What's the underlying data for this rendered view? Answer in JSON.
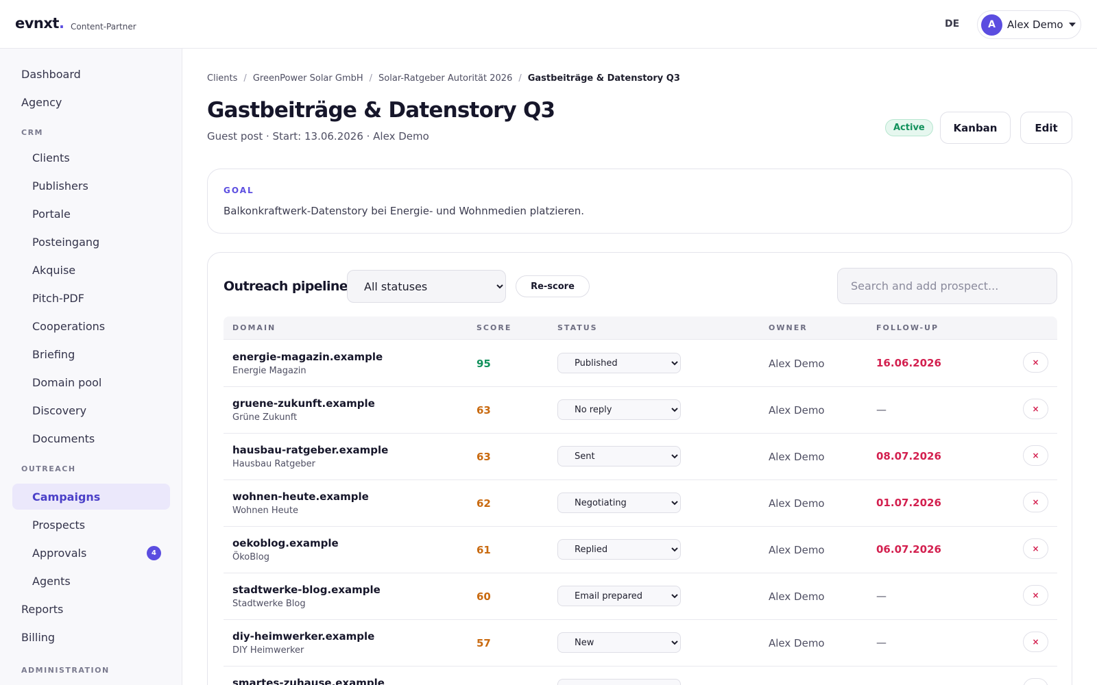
{
  "header": {
    "logo_text": "evnxt",
    "logo_dot": ".",
    "logo_sub": "Content-Partner",
    "language": "DE",
    "user_initial": "A",
    "user_name": "Alex Demo"
  },
  "sidebar": {
    "top_items": [
      {
        "label": "Dashboard"
      },
      {
        "label": "Agency"
      }
    ],
    "crm_section": "CRM",
    "crm_items": [
      {
        "label": "Clients"
      },
      {
        "label": "Publishers"
      },
      {
        "label": "Portale"
      },
      {
        "label": "Posteingang"
      },
      {
        "label": "Akquise"
      },
      {
        "label": "Pitch-PDF"
      },
      {
        "label": "Cooperations"
      },
      {
        "label": "Briefing"
      },
      {
        "label": "Domain pool"
      },
      {
        "label": "Discovery"
      },
      {
        "label": "Documents"
      }
    ],
    "outreach_section": "OUTREACH",
    "outreach_items": [
      {
        "label": "Campaigns",
        "active": true
      },
      {
        "label": "Prospects"
      },
      {
        "label": "Approvals",
        "badge": "4"
      },
      {
        "label": "Agents"
      }
    ],
    "bottom_items": [
      {
        "label": "Reports"
      },
      {
        "label": "Billing"
      }
    ],
    "admin_section": "ADMINISTRATION"
  },
  "breadcrumb": {
    "items": [
      "Clients",
      "GreenPower Solar GmbH",
      "Solar-Ratgeber Autorität 2026"
    ],
    "current": "Gastbeiträge & Datenstory Q3",
    "separator": "/"
  },
  "page": {
    "title": "Gastbeiträge & Datenstory Q3",
    "subtitle": "Guest post · Start: 13.06.2026 · Alex Demo",
    "status": "Active",
    "kanban_label": "Kanban",
    "edit_label": "Edit"
  },
  "goal": {
    "label": "GOAL",
    "text": "Balkonkraftwerk-Datenstory bei Energie- und Wohnmedien platzieren."
  },
  "pipeline": {
    "title": "Outreach pipeline",
    "status_filter": "All statuses",
    "rescore_label": "Re-score",
    "search_placeholder": "Search and add prospect...",
    "columns": {
      "domain": "DOMAIN",
      "score": "SCORE",
      "status": "STATUS",
      "owner": "OWNER",
      "followup": "FOLLOW-UP"
    },
    "delete_glyph": "×",
    "rows": [
      {
        "domain": "energie-magazin.example",
        "name": "Energie Magazin",
        "score": "95",
        "score_color": "#12915c",
        "status": "Published",
        "owner": "Alex Demo",
        "followup": "16.06.2026",
        "followup_due": true
      },
      {
        "domain": "gruene-zukunft.example",
        "name": "Grüne Zukunft",
        "score": "63",
        "score_color": "#c96a10",
        "status": "No reply",
        "owner": "Alex Demo",
        "followup": "—",
        "followup_due": false
      },
      {
        "domain": "hausbau-ratgeber.example",
        "name": "Hausbau Ratgeber",
        "score": "63",
        "score_color": "#c96a10",
        "status": "Sent",
        "owner": "Alex Demo",
        "followup": "08.07.2026",
        "followup_due": true
      },
      {
        "domain": "wohnen-heute.example",
        "name": "Wohnen Heute",
        "score": "62",
        "score_color": "#c96a10",
        "status": "Negotiating",
        "owner": "Alex Demo",
        "followup": "01.07.2026",
        "followup_due": true
      },
      {
        "domain": "oekoblog.example",
        "name": "ÖkoBlog",
        "score": "61",
        "score_color": "#c96a10",
        "status": "Replied",
        "owner": "Alex Demo",
        "followup": "06.07.2026",
        "followup_due": true
      },
      {
        "domain": "stadtwerke-blog.example",
        "name": "Stadtwerke Blog",
        "score": "60",
        "score_color": "#c96a10",
        "status": "Email prepared",
        "owner": "Alex Demo",
        "followup": "—",
        "followup_due": false
      },
      {
        "domain": "diy-heimwerker.example",
        "name": "DIY Heimwerker",
        "score": "57",
        "score_color": "#c96a10",
        "status": "New",
        "owner": "Alex Demo",
        "followup": "—",
        "followup_due": false
      },
      {
        "domain": "smartes-zuhause.example",
        "name": "",
        "score": "",
        "score_color": "#c96a10",
        "status": "",
        "owner": "",
        "followup": "",
        "followup_due": false
      }
    ]
  }
}
